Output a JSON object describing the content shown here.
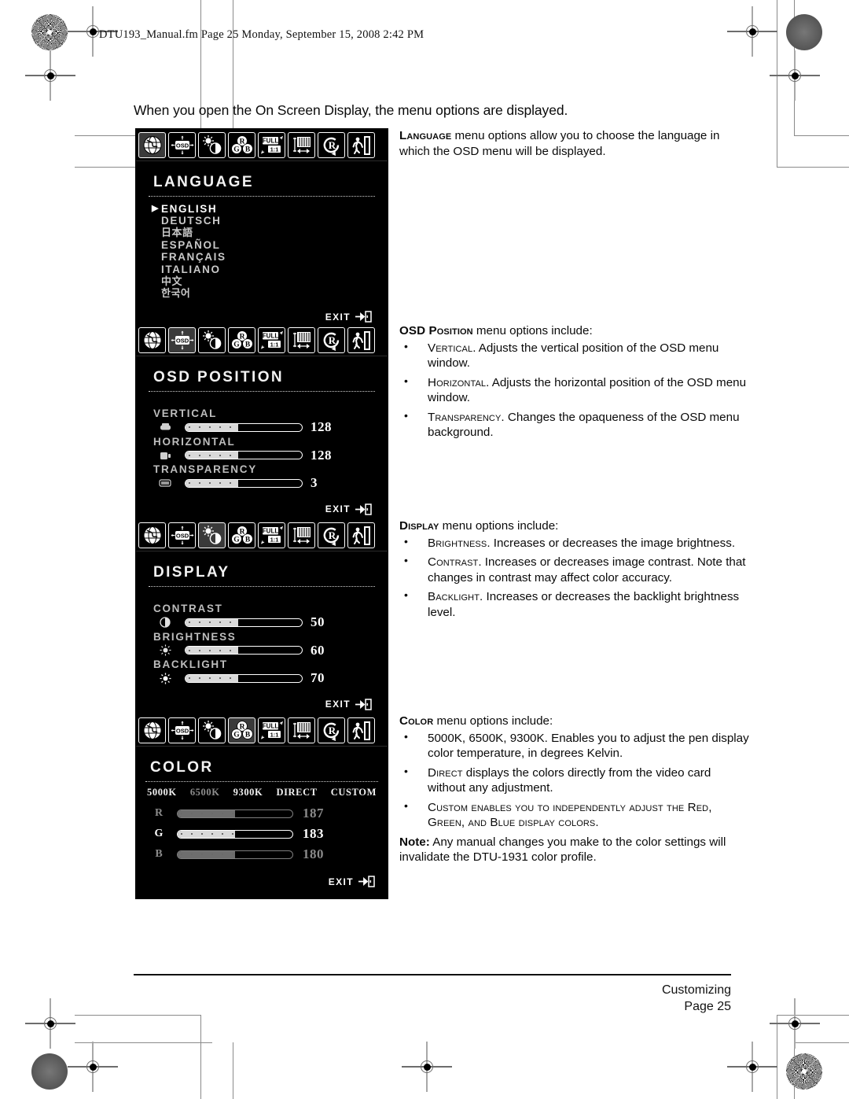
{
  "file_header": "DTU193_Manual.fm  Page 25  Monday, September 15, 2008  2:42 PM",
  "intro": "When you open the On Screen Display, the menu options are displayed.",
  "icon_bar": [
    {
      "name": "globe-icon",
      "title": "Language"
    },
    {
      "name": "osd-position-icon",
      "title": "OSD Position"
    },
    {
      "name": "brightness-contrast-icon",
      "title": "Display"
    },
    {
      "name": "rgb-color-icon",
      "title": "Color"
    },
    {
      "name": "full-scaling-icon",
      "title": "Scaling"
    },
    {
      "name": "image-adjust-icon",
      "title": "Image Adjust"
    },
    {
      "name": "reset-icon",
      "title": "Reset"
    },
    {
      "name": "exit-icon",
      "title": "Exit"
    }
  ],
  "figures": {
    "language": {
      "title": "LANGUAGE",
      "selected_icon_index": 0,
      "exit_label": "EXIT",
      "options": [
        {
          "label": "ENGLISH",
          "selected": true,
          "script": "latin"
        },
        {
          "label": "DEUTSCH",
          "selected": false,
          "script": "latin"
        },
        {
          "label": "日本語",
          "selected": false,
          "script": "cjk"
        },
        {
          "label": "ESPAÑOL",
          "selected": false,
          "script": "latin"
        },
        {
          "label": "FRANÇAIS",
          "selected": false,
          "script": "latin"
        },
        {
          "label": "ITALIANO",
          "selected": false,
          "script": "latin"
        },
        {
          "label": "中文",
          "selected": false,
          "script": "cjk"
        },
        {
          "label": "한국어",
          "selected": false,
          "script": "cjk"
        }
      ]
    },
    "osd_position": {
      "title": "OSD POSITION",
      "selected_icon_index": 1,
      "exit_label": "EXIT",
      "settings": [
        {
          "label": "VERTICAL",
          "value": "128",
          "fill_percent": 45,
          "glyph": "vertical-position-icon"
        },
        {
          "label": "HORIZONTAL",
          "value": "128",
          "fill_percent": 45,
          "glyph": "horizontal-position-icon"
        },
        {
          "label": "TRANSPARENCY",
          "value": "3",
          "fill_percent": 45,
          "glyph": "transparency-icon"
        }
      ]
    },
    "display": {
      "title": "DISPLAY",
      "selected_icon_index": 2,
      "exit_label": "EXIT",
      "settings": [
        {
          "label": "CONTRAST",
          "value": "50",
          "fill_percent": 45,
          "glyph": "contrast-icon"
        },
        {
          "label": "BRIGHTNESS",
          "value": "60",
          "fill_percent": 45,
          "glyph": "brightness-icon"
        },
        {
          "label": "BACKLIGHT",
          "value": "70",
          "fill_percent": 45,
          "glyph": "backlight-icon"
        }
      ]
    },
    "color": {
      "title": "COLOR",
      "selected_icon_index": 3,
      "exit_label": "EXIT",
      "tabs": [
        {
          "label": "5000K",
          "dim": false
        },
        {
          "label": "6500K",
          "dim": true
        },
        {
          "label": "9300K",
          "dim": false
        },
        {
          "label": "DIRECT",
          "dim": false
        },
        {
          "label": "CUSTOM",
          "dim": false
        }
      ],
      "channels": [
        {
          "label": "R",
          "value": "187",
          "fill_percent": 50,
          "active": false
        },
        {
          "label": "G",
          "value": "183",
          "fill_percent": 50,
          "active": true
        },
        {
          "label": "B",
          "value": "180",
          "fill_percent": 50,
          "active": false
        }
      ]
    }
  },
  "text_blocks": {
    "language": {
      "lead_term": "Language",
      "lead_rest": " menu options allow you to choose the language in which the OSD menu will be displayed."
    },
    "osd_position": {
      "lead_term": "OSD Position",
      "lead_rest": " menu options include:",
      "bullets": [
        {
          "term": "Vertical",
          "rest": ".  Adjusts the vertical position of the OSD menu window."
        },
        {
          "term": "Horizontal",
          "rest": ".  Adjusts the horizontal position of the OSD menu window."
        },
        {
          "term": "Transparency",
          "rest": ".  Changes the opaqueness of the OSD menu background."
        }
      ]
    },
    "display": {
      "lead_term": "Display",
      "lead_rest": " menu options include:",
      "bullets": [
        {
          "term": "Brightness",
          "rest": ".  Increases or decreases the image brightness."
        },
        {
          "term": "Contrast",
          "rest": ".  Increases or decreases image contrast. Note that changes in contrast may affect color accuracy."
        },
        {
          "term": "Backlight",
          "rest": ".  Increases or decreases the backlight brightness level."
        }
      ]
    },
    "color": {
      "lead_term": "Color",
      "lead_rest": " menu options include:",
      "bullets": [
        {
          "term": "",
          "rest": "5000K, 6500K, 9300K.  Enables you to adjust the pen display color temperature, in degrees Kelvin."
        },
        {
          "term": "Direct",
          "rest": " displays the colors directly from the video card without any adjustment."
        },
        {
          "term": "Custom",
          "rest": " enables you to independently adjust the Red, Green, and Blue display colors."
        }
      ],
      "note_label": "Note:",
      "note_text": " Any manual changes you make to the color settings will invalidate the DTU-1931 color profile."
    }
  },
  "footer": {
    "section": "Customizing",
    "page": "Page  25"
  }
}
